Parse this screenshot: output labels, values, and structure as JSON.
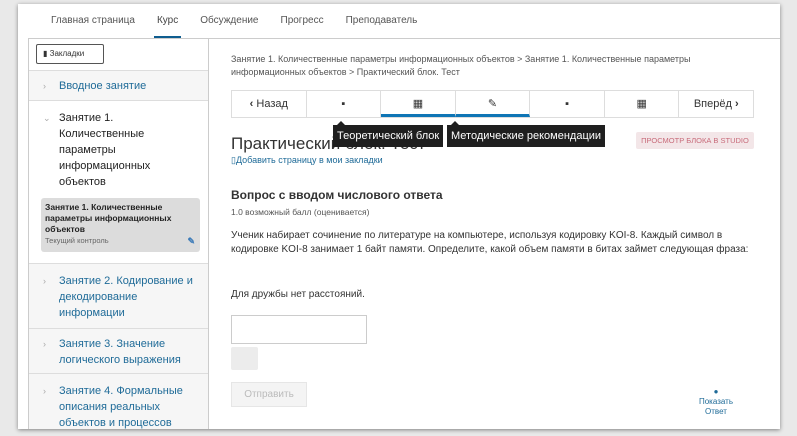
{
  "topnav": [
    "Главная страница",
    "Курс",
    "Обсуждение",
    "Прогресс",
    "Преподаватель"
  ],
  "sidebar": {
    "bookmarks": "Закладки",
    "items": [
      "Вводное занятие",
      "Занятие 1. Количественные параметры информационных объектов",
      "Занятие 2. Кодирование и декодирование информации",
      "Занятие 3. Значение логического выражения",
      "Занятие 4. Формальные описания реальных объектов и процессов"
    ],
    "sub": {
      "title": "Занятие 1. Количественные параметры информационных объектов",
      "meta": "Текущий контроль"
    }
  },
  "main": {
    "breadcrumb": "Занятие 1. Количественные параметры информационных объектов > Занятие 1. Количественные параметры информационных объектов > Практический блок. Тест",
    "prev": "Назад",
    "next": "Вперёд",
    "tooltips": [
      "Теоретический блок",
      "Методические рекомендации"
    ],
    "title": "Практический блок. Тест",
    "studio": "ПРОСМОТР БЛОКА В STUDIO",
    "add_bookmark": "Добавить страницу в мои закладки",
    "question_heading": "Вопрос с вводом числового ответа",
    "question_points": "1.0 возможный балл (оценивается)",
    "question_text": "Ученик набирает сочинение по литературе на компьютере, используя кодировку KOI-8. Каждый символ в кодировке KOI-8 занимает 1 байт памяти. Определите, какой объем памяти в битах займет следующая фраза:",
    "phrase": "Для дружбы нет расстояний.",
    "answer_value": "",
    "submit": "Отправить",
    "show_answer": "Показать Ответ"
  }
}
